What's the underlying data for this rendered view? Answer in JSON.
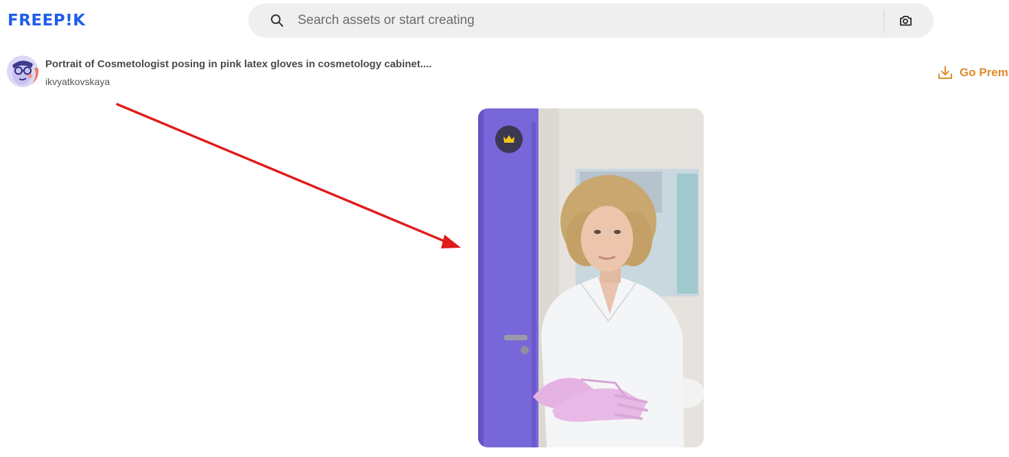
{
  "header": {
    "logo": "FREEP!K",
    "search": {
      "placeholder": "Search assets or start creating",
      "search_icon": "search-icon",
      "visual_search_icon": "camera-icon"
    }
  },
  "asset": {
    "title": "Portrait of Cosmetologist posing in pink latex gloves in cosmetology cabinet....",
    "author": "ikvyatkovskaya",
    "premium_badge_icon": "crown-icon"
  },
  "actions": {
    "premium_label": "Go Prem",
    "premium_icon": "download-icon"
  },
  "colors": {
    "brand": "#1f5ee8",
    "premium": "#e08a2b",
    "annotation_arrow": "#e01b1b",
    "door": "#7462d6",
    "gloves": "#e5b2e3"
  }
}
